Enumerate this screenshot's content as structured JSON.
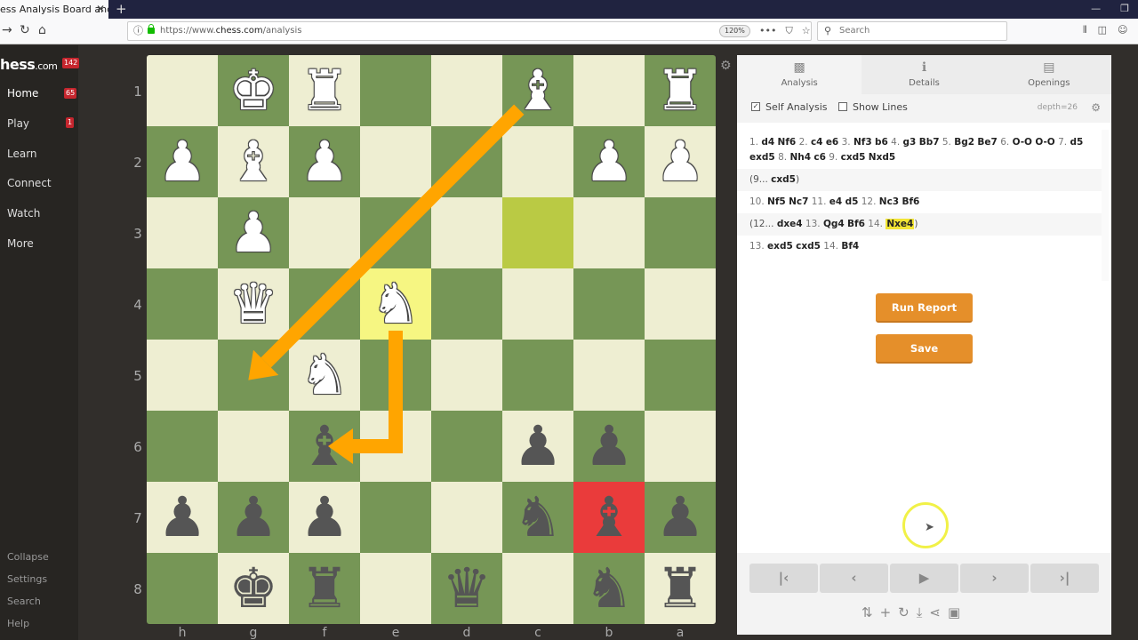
{
  "browser": {
    "tab_title": "ess Analysis Board and PGN",
    "tab_close": "✕",
    "new_tab": "+",
    "window_controls": [
      "—",
      "❐"
    ],
    "nav": {
      "back": "→",
      "reload": "↻",
      "home": "⌂"
    },
    "url_prefix": "https://www.",
    "url_domain": "chess.com",
    "url_path": "/analysis",
    "zoom": "120%",
    "page_actions": [
      "•••",
      "⛉",
      "☆"
    ],
    "search_placeholder": "Search",
    "right_icons": [
      "library-icon",
      "sidebar-icon",
      "account-icon"
    ]
  },
  "sidebar": {
    "logo_main": "hess",
    "logo_suffix": ".com",
    "logo_badge": "142",
    "items": [
      {
        "label": "Home",
        "badge": "65"
      },
      {
        "label": "Play",
        "badge": "1"
      },
      {
        "label": "Learn",
        "badge": null
      },
      {
        "label": "Connect",
        "badge": null
      },
      {
        "label": "Watch",
        "badge": null
      },
      {
        "label": "More",
        "badge": null
      }
    ],
    "footer": [
      "Collapse",
      "Settings",
      "Search",
      "Help"
    ]
  },
  "board": {
    "orientation": "black",
    "rank_labels": [
      "1",
      "2",
      "3",
      "4",
      "5",
      "6",
      "7",
      "8"
    ],
    "file_labels": [
      "h",
      "g",
      "f",
      "e",
      "d",
      "c",
      "b",
      "a"
    ],
    "rows": [
      [
        "",
        "wK",
        "wR",
        "",
        "",
        "wB",
        "",
        "wR"
      ],
      [
        "wP",
        "wB",
        "wP",
        "",
        "",
        "",
        "wP",
        "wP"
      ],
      [
        "",
        "wP",
        "",
        "",
        "",
        "",
        "",
        ""
      ],
      [
        "",
        "wQ",
        "",
        "wN",
        "",
        "",
        "",
        ""
      ],
      [
        "",
        "",
        "wN",
        "",
        "",
        "",
        "",
        ""
      ],
      [
        "",
        "",
        "bB",
        "",
        "",
        "bP",
        "bP",
        ""
      ],
      [
        "bP",
        "bP",
        "bP",
        "",
        "",
        "bN",
        "bB",
        "bP"
      ],
      [
        "",
        "bK",
        "bR",
        "",
        "bQ",
        "",
        "bN",
        "bR"
      ]
    ],
    "highlights": [
      {
        "square": "e4",
        "type": "yellow"
      },
      {
        "square": "c3",
        "type": "green"
      },
      {
        "square": "b7",
        "type": "red"
      }
    ],
    "arrows": [
      {
        "from": "c1",
        "to": "g5",
        "color": "#ffa500"
      },
      {
        "from": "e4",
        "to": "f6",
        "color": "#ffa500",
        "shape": "knight"
      }
    ],
    "colors": {
      "light": "#eeeed2",
      "dark": "#769656",
      "arrow": "#ffa500"
    }
  },
  "panel": {
    "tabs": [
      {
        "label": "Analysis",
        "icon": "analysis-icon",
        "active": true
      },
      {
        "label": "Details",
        "icon": "info-icon",
        "active": false
      },
      {
        "label": "Openings",
        "icon": "book-icon",
        "active": false
      }
    ],
    "self_analysis": {
      "label": "Self Analysis",
      "checked": true
    },
    "show_lines": {
      "label": "Show Lines",
      "checked": false
    },
    "depth": "depth=26",
    "move_rows": [
      {
        "variation": false,
        "tokens": [
          [
            "n",
            "1."
          ],
          [
            "m",
            "d4"
          ],
          [
            "m",
            "Nf6"
          ],
          [
            "n",
            "2."
          ],
          [
            "m",
            "c4"
          ],
          [
            "m",
            "e6"
          ],
          [
            "n",
            "3."
          ],
          [
            "m",
            "Nf3"
          ],
          [
            "m",
            "b6"
          ],
          [
            "n",
            "4."
          ],
          [
            "m",
            "g3"
          ],
          [
            "m",
            "Bb7"
          ],
          [
            "n",
            "5."
          ],
          [
            "m",
            "Bg2"
          ],
          [
            "m",
            "Be7"
          ],
          [
            "n",
            "6."
          ],
          [
            "m",
            "O-O"
          ],
          [
            "m",
            "O-O"
          ],
          [
            "n",
            "7."
          ],
          [
            "m",
            "d5"
          ],
          [
            "m",
            "exd5"
          ],
          [
            "n",
            "8."
          ],
          [
            "m",
            "Nh4"
          ],
          [
            "m",
            "c6"
          ],
          [
            "n",
            "9."
          ],
          [
            "m",
            "cxd5"
          ],
          [
            "m",
            "Nxd5"
          ]
        ]
      },
      {
        "variation": true,
        "tokens": [
          [
            "p",
            "(9..."
          ],
          [
            "m",
            "cxd5"
          ],
          [
            "p",
            ")"
          ]
        ]
      },
      {
        "variation": false,
        "tokens": [
          [
            "n",
            "10."
          ],
          [
            "m",
            "Nf5"
          ],
          [
            "m",
            "Nc7"
          ],
          [
            "n",
            "11."
          ],
          [
            "m",
            "e4"
          ],
          [
            "m",
            "d5"
          ],
          [
            "n",
            "12."
          ],
          [
            "m",
            "Nc3"
          ],
          [
            "m",
            "Bf6"
          ]
        ]
      },
      {
        "variation": true,
        "tokens": [
          [
            "p",
            "(12..."
          ],
          [
            "m",
            "dxe4"
          ],
          [
            "n",
            "13."
          ],
          [
            "m",
            "Qg4"
          ],
          [
            "m",
            "Bf6"
          ],
          [
            "n",
            "14."
          ],
          [
            "h",
            "Nxe4"
          ],
          [
            "p",
            ")"
          ]
        ]
      },
      {
        "variation": false,
        "tokens": [
          [
            "n",
            "13."
          ],
          [
            "m",
            "exd5"
          ],
          [
            "m",
            "cxd5"
          ],
          [
            "n",
            "14."
          ],
          [
            "m",
            "Bf4"
          ]
        ]
      }
    ],
    "run_report": "Run Report",
    "save": "Save",
    "controls": [
      "first-move",
      "previous-move",
      "play",
      "next-move",
      "last-move"
    ],
    "control_glyphs": [
      "|‹",
      "‹",
      "▶",
      "›",
      "›|"
    ],
    "tools": [
      {
        "name": "flip-board-icon",
        "glyph": "⇅"
      },
      {
        "name": "add-icon",
        "glyph": "+"
      },
      {
        "name": "reset-icon",
        "glyph": "↻"
      },
      {
        "name": "download-icon",
        "glyph": "⤓"
      },
      {
        "name": "share-icon",
        "glyph": "⋖"
      },
      {
        "name": "vs-computer-icon",
        "glyph": "▣"
      }
    ],
    "accent": "#e58f2a"
  }
}
